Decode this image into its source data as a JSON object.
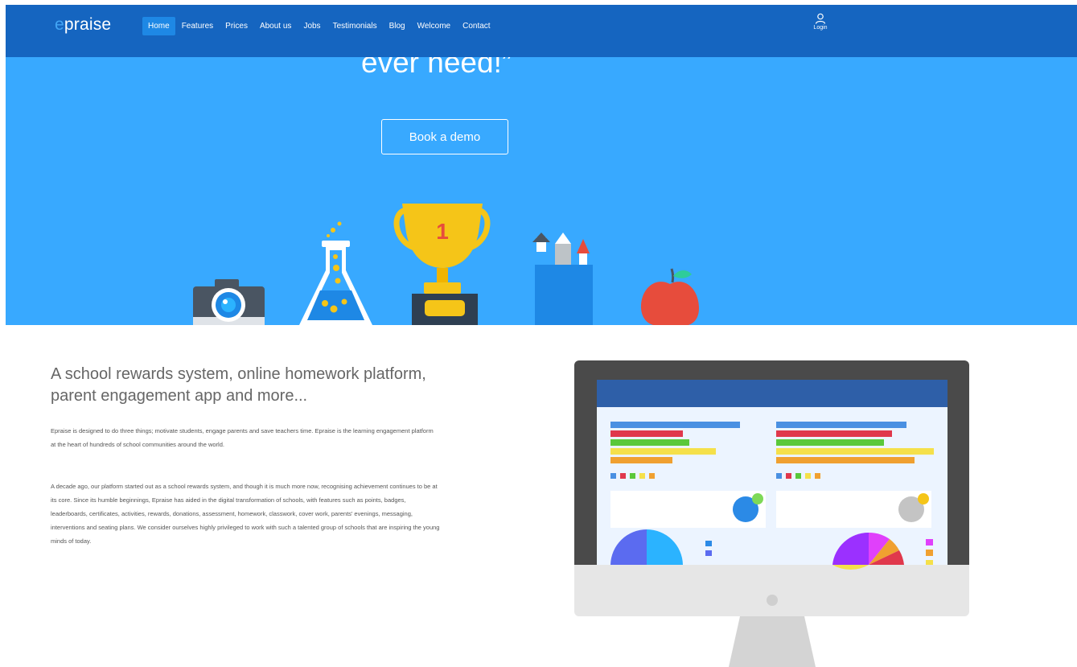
{
  "brand": {
    "prefix": "e",
    "rest": "praise"
  },
  "nav": [
    {
      "label": "Home",
      "active": true
    },
    {
      "label": "Features"
    },
    {
      "label": "Prices"
    },
    {
      "label": "About us"
    },
    {
      "label": "Jobs"
    },
    {
      "label": "Testimonials"
    },
    {
      "label": "Blog"
    },
    {
      "label": "Welcome"
    },
    {
      "label": "Contact"
    }
  ],
  "login": {
    "label": "Login",
    "icon": "user-icon"
  },
  "hero": {
    "quote": "ever need!”",
    "cta": "Book a demo",
    "trophy_number": "1",
    "colors": {
      "background": "#38a9ff",
      "header": "#1565c0"
    }
  },
  "content": {
    "title": "A school rewards system, online homework platform, parent engagement app and more...",
    "para1": "Epraise is designed to do three things; motivate students, engage parents and save teachers time. Epraise is the learning engagement platform at the heart of hundreds of school communities around the world.",
    "para2": "A decade ago, our platform started out as a school rewards system, and though it is much more now, recognising achievement continues to be at its core. Since its humble beginnings, Epraise has aided in the digital transformation of schools, with features such as points, badges, leaderboards, certificates, activities, rewards, donations, assessment, homework, classwork, cover work, parents' evenings, messaging, interventions and seating plans. We consider ourselves highly privileged to work with such a talented group of schools that are inspiring the young minds of today."
  }
}
